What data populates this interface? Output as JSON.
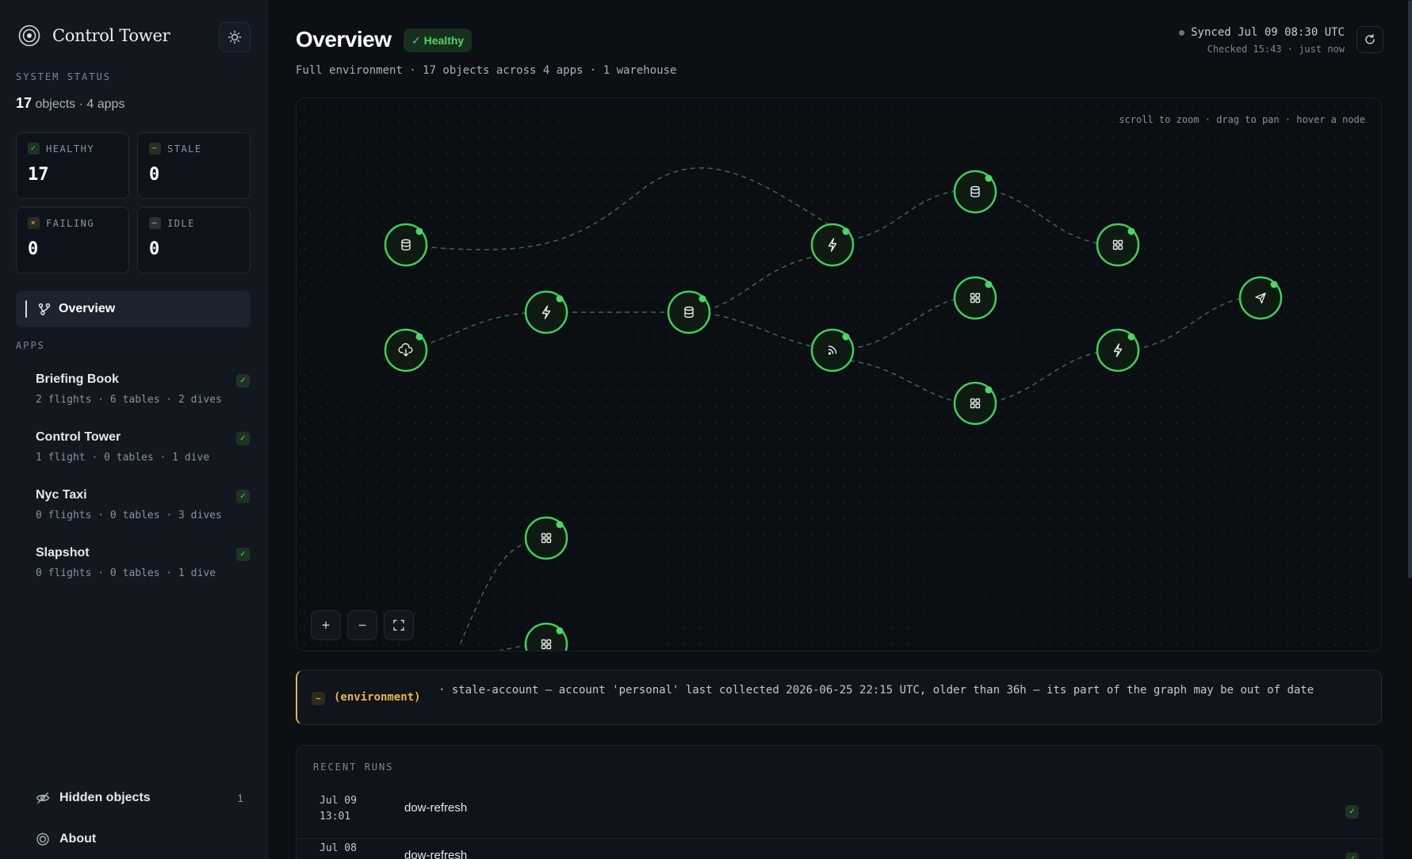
{
  "brand": {
    "title": "Control Tower",
    "logo_icon": "target-icon",
    "theme_icon": "sun-icon"
  },
  "sidebar": {
    "system_status_label": "SYSTEM STATUS",
    "summary": {
      "objects_count": "17",
      "objects_rest": "objects · 4 apps"
    },
    "stats": [
      {
        "label": "HEALTHY",
        "value": "17",
        "glyph": "✓"
      },
      {
        "label": "STALE",
        "value": "0",
        "glyph": "~"
      },
      {
        "label": "FAILING",
        "value": "0",
        "glyph": "×"
      },
      {
        "label": "IDLE",
        "value": "0",
        "glyph": "–"
      }
    ],
    "nav_overview": "Overview",
    "apps_label": "APPS",
    "apps": [
      {
        "name": "Briefing Book",
        "meta": "2 flights · 6 tables · 2 dives"
      },
      {
        "name": "Control Tower",
        "meta": "1 flight · 0 tables · 1 dive"
      },
      {
        "name": "Nyc Taxi",
        "meta": "0 flights · 0 tables · 3 dives"
      },
      {
        "name": "Slapshot",
        "meta": "0 flights · 0 tables · 1 dive"
      }
    ],
    "check_glyph": "✓",
    "hidden": {
      "label": "Hidden objects",
      "count": "1"
    },
    "about": {
      "label": "About"
    }
  },
  "header": {
    "title": "Overview",
    "status": "✓ Healthy",
    "subtitle": "Full environment · 17 objects across 4 apps · 1 warehouse",
    "synced": "Synced Jul 09 08:30 UTC",
    "checked": "Checked 15:43 · just now"
  },
  "graph": {
    "hint": "scroll to zoom · drag to pan · hover a node",
    "zoom_in": "+",
    "zoom_out": "−",
    "status_color": "#4fd36b"
  },
  "warning": {
    "glyph": "~",
    "scope": "(environment)",
    "text": "· stale-account — account 'personal' last collected 2026-06-25 22:15 UTC, older than 36h — its part of the graph may be out of date"
  },
  "runs": {
    "label": "RECENT RUNS",
    "items": [
      {
        "date": "Jul 09",
        "time": "13:01",
        "name": "dow-refresh"
      },
      {
        "date": "Jul 08",
        "time": "",
        "name": "dow-refresh"
      }
    ]
  }
}
